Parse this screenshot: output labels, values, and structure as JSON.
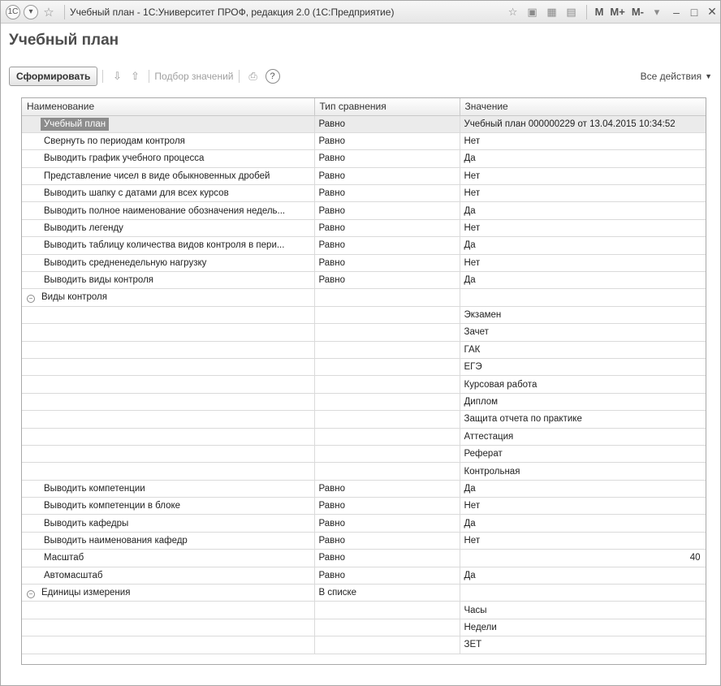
{
  "window": {
    "title": "Учебный план - 1С:Университет ПРОФ, редакция 2.0  (1С:Предприятие)",
    "buttons": [
      "M",
      "M+",
      "M-"
    ]
  },
  "form": {
    "title": "Учебный план"
  },
  "toolbar": {
    "generate_label": "Сформировать",
    "pick_values_label": "Подбор значений",
    "help_label": "?",
    "all_actions_label": "Все действия"
  },
  "table": {
    "columns": [
      "Наименование",
      "Тип сравнения",
      "Значение"
    ],
    "rows": [
      {
        "name": "Учебный план",
        "cmp": "Равно",
        "value": "Учебный план 000000229 от 13.04.2015 10:34:52"
      },
      {
        "name": "Свернуть по периодам контроля",
        "cmp": "Равно",
        "value": "Нет"
      },
      {
        "name": "Выводить график учебного процесса",
        "cmp": "Равно",
        "value": "Да"
      },
      {
        "name": "Представление чисел в виде обыкновенных дробей",
        "cmp": "Равно",
        "value": "Нет"
      },
      {
        "name": "Выводить шапку с датами для всех курсов",
        "cmp": "Равно",
        "value": "Нет"
      },
      {
        "name": "Выводить полное наименование обозначения недель...",
        "cmp": "Равно",
        "value": "Да"
      },
      {
        "name": "Выводить легенду",
        "cmp": "Равно",
        "value": "Нет"
      },
      {
        "name": "Выводить таблицу количества видов контроля в пери...",
        "cmp": "Равно",
        "value": "Да"
      },
      {
        "name": "Выводить средненедельную нагрузку",
        "cmp": "Равно",
        "value": "Нет"
      },
      {
        "name": "Выводить виды контроля",
        "cmp": "Равно",
        "value": "Да"
      },
      {
        "name": "Виды контроля",
        "cmp": "",
        "value": ""
      },
      {
        "name": "",
        "cmp": "",
        "value": "Экзамен"
      },
      {
        "name": "",
        "cmp": "",
        "value": "Зачет"
      },
      {
        "name": "",
        "cmp": "",
        "value": "ГАК"
      },
      {
        "name": "",
        "cmp": "",
        "value": "ЕГЭ"
      },
      {
        "name": "",
        "cmp": "",
        "value": "Курсовая работа"
      },
      {
        "name": "",
        "cmp": "",
        "value": "Диплом"
      },
      {
        "name": "",
        "cmp": "",
        "value": "Защита отчета по практике"
      },
      {
        "name": "",
        "cmp": "",
        "value": "Аттестация"
      },
      {
        "name": "",
        "cmp": "",
        "value": "Реферат"
      },
      {
        "name": "",
        "cmp": "",
        "value": "Контрольная"
      },
      {
        "name": "Выводить компетенции",
        "cmp": "Равно",
        "value": "Да"
      },
      {
        "name": "Выводить компетенции в блоке",
        "cmp": "Равно",
        "value": "Нет"
      },
      {
        "name": "Выводить кафедры",
        "cmp": "Равно",
        "value": "Да"
      },
      {
        "name": "Выводить наименования кафедр",
        "cmp": "Равно",
        "value": "Нет"
      },
      {
        "name": "Масштаб",
        "cmp": "Равно",
        "value": "40"
      },
      {
        "name": "Автомасштаб",
        "cmp": "Равно",
        "value": "Да"
      },
      {
        "name": "Единицы измерения",
        "cmp": "В списке",
        "value": ""
      },
      {
        "name": "",
        "cmp": "",
        "value": "Часы"
      },
      {
        "name": "",
        "cmp": "",
        "value": "Недели"
      },
      {
        "name": "",
        "cmp": "",
        "value": "ЗЕТ"
      }
    ]
  }
}
